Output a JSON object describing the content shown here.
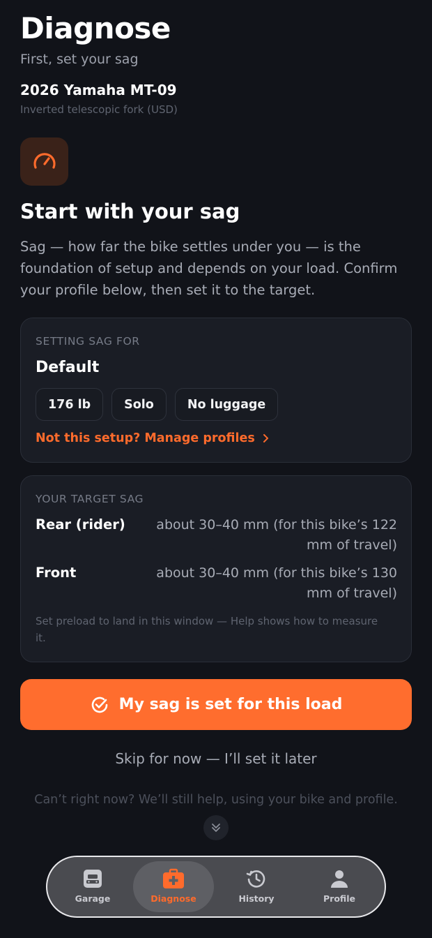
{
  "header": {
    "title": "Diagnose",
    "subtitle": "First, set your sag"
  },
  "bike": {
    "name": "2026 Yamaha MT-09",
    "fork": "Inverted telescopic fork (USD)"
  },
  "intro": {
    "icon": "gauge-icon",
    "heading": "Start with your sag",
    "body": "Sag — how far the bike settles under you — is the foundation of setup and depends on your load. Confirm your profile below, then set it to the target."
  },
  "profile_card": {
    "eyebrow": "SETTING SAG FOR",
    "profile_name": "Default",
    "chips": [
      "176 lb",
      "Solo",
      "No luggage"
    ],
    "manage_link": "Not this setup? Manage profiles"
  },
  "target_card": {
    "eyebrow": "YOUR TARGET SAG",
    "rows": [
      {
        "label": "Rear (rider)",
        "value": "about 30–40 mm (for this bike’s 122 mm of travel)"
      },
      {
        "label": "Front",
        "value": "about 30–40 mm (for this bike’s 130 mm of travel)"
      }
    ],
    "note": "Set preload to land in this window — Help shows how to measure it."
  },
  "actions": {
    "confirm_label": "My sag is set for this load",
    "skip_label": "Skip for now — I’ll set it later",
    "fallback_text": "Can’t right now? We’ll still help, using your bike and profile."
  },
  "tabbar": {
    "items": [
      {
        "label": "Garage",
        "icon": "garage-icon",
        "active": false
      },
      {
        "label": "Diagnose",
        "icon": "first-aid-icon",
        "active": true
      },
      {
        "label": "History",
        "icon": "history-icon",
        "active": false
      },
      {
        "label": "Profile",
        "icon": "profile-icon",
        "active": false
      }
    ]
  },
  "colors": {
    "accent": "#ff6d2e",
    "background": "#111319",
    "card": "#1a1d25"
  }
}
